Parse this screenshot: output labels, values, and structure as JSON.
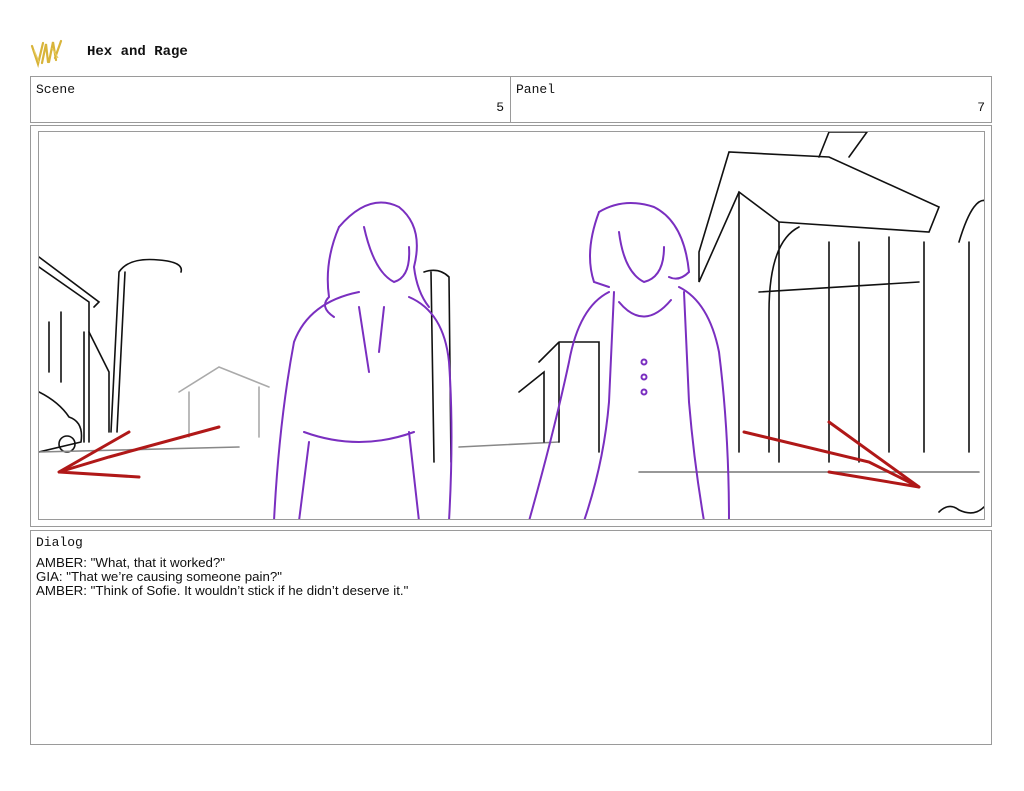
{
  "header": {
    "title": "Hex and Rage",
    "logo_icon": "signature-logo-icon"
  },
  "scene": {
    "label": "Scene",
    "value": "5"
  },
  "panel": {
    "label": "Panel",
    "value": "7"
  },
  "frame": {
    "description_icon": "storyboard-sketch-image"
  },
  "dialog": {
    "label": "Dialog",
    "lines": [
      "AMBER: \"What, that it worked?\"",
      "GIA: \"That we’re causing someone pain?\"",
      "AMBER: \"Think of Sofie. It wouldn’t stick if he didn’t deserve it.\""
    ]
  },
  "colors": {
    "sketch_purple": "#7a2fc0",
    "arrow_red": "#b01818",
    "line_black": "#111111",
    "border_gray": "#9a9a9a",
    "logo_gold": "#d8b43a"
  }
}
